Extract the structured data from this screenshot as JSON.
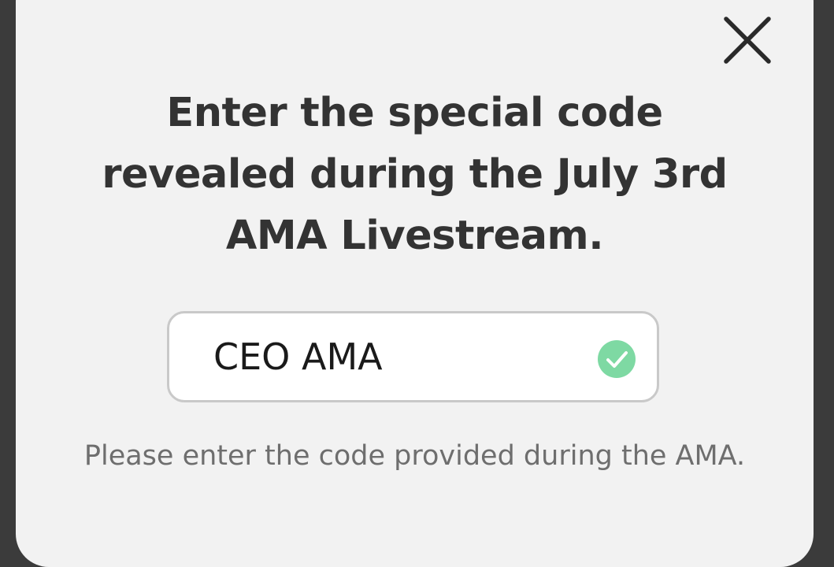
{
  "dialog": {
    "close_icon": "close-icon",
    "title": "Enter the special code revealed during the July 3rd AMA Livestream.",
    "code_input": {
      "value": "CEO AMA",
      "placeholder": ""
    },
    "valid_icon": "check-circle-icon",
    "helper_text": "Please enter the code provided during the AMA."
  },
  "colors": {
    "backdrop": "#3b3b3b",
    "dialog_background": "#f2f2f2",
    "title_text": "#333333",
    "helper_text": "#6e6e6e",
    "input_border": "#c9c9c9",
    "success_green": "#7ed9a3"
  }
}
